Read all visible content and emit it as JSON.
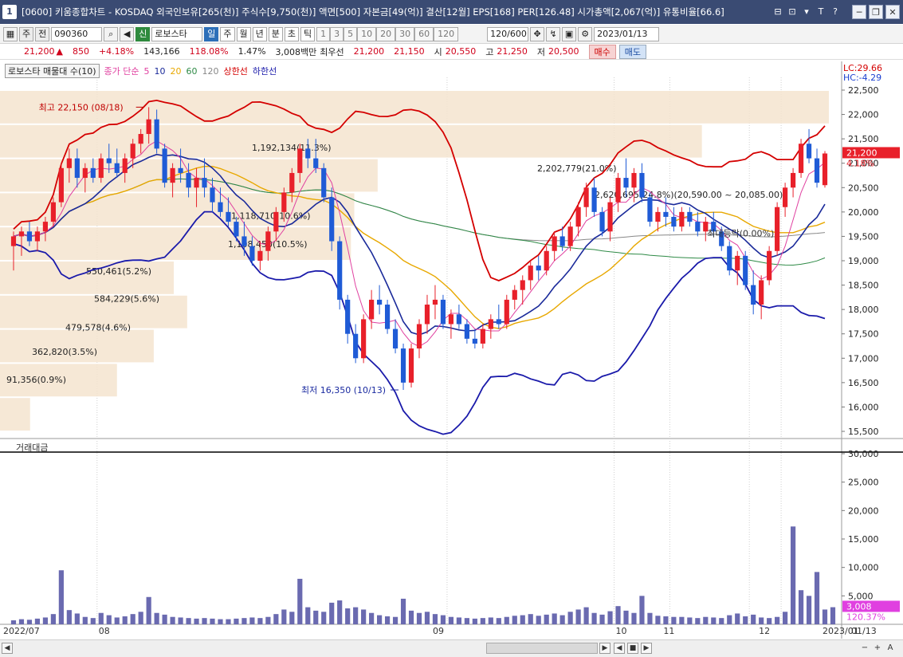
{
  "window": {
    "num": "1",
    "title": "[0600] 키움종합차트 - KOSDAQ 외국인보유[265(천)] 주식수[9,750(천)] 액면[500] 자본금[49(억)] 결산[12월] EPS[168] PER[126.48] 시가총액[2,067(억)] 유통비율[66.6]",
    "tools": [
      "⊟",
      "⊡",
      "▾",
      "T",
      "?"
    ],
    "minimize": "─",
    "restore": "❐",
    "close": "✕"
  },
  "toolbar": {
    "period": "주",
    "market": "전",
    "code": "090360",
    "credit": "신",
    "name": "로보스타",
    "tabs": [
      "일",
      "주",
      "월",
      "년",
      "분",
      "초",
      "틱"
    ],
    "active_tab": "일",
    "intervals": [
      "1",
      "3",
      "5",
      "10",
      "20",
      "30",
      "60",
      "120"
    ],
    "count": "120/600",
    "date": "2023/01/13"
  },
  "quote": {
    "price": "21,200",
    "arrow": "▲",
    "change": "850",
    "rate": "+4.18%",
    "volume": "143,166",
    "vol_ratio": "118.08%",
    "turnover": "1.47%",
    "amount": "3,008백만",
    "bid_label": "최우선",
    "bid1": "21,200",
    "bid2": "21,150",
    "open_label": "시",
    "open": "20,550",
    "high_label": "고",
    "high": "21,250",
    "low_label": "저",
    "low": "20,500",
    "buy": "매수",
    "sell": "매도"
  },
  "legend": {
    "indicator": "로보스타 매물대 수(10)",
    "ma_label": "종가 단순",
    "ma": [
      "5",
      "10",
      "20",
      "60",
      "120"
    ],
    "upper": "상한선",
    "lower": "하한선"
  },
  "colors": {
    "up": "#e8202a",
    "down": "#1f5bd6",
    "ma5": "#e040a0",
    "ma10": "#1a2a9a",
    "ma20": "#e8a800",
    "ma60": "#2e8a46",
    "ma120": "#888888",
    "bb": "#d40000",
    "bbLow": "#1a1aaa",
    "profile": "#f5e4cf",
    "volume": "#6a6ab0"
  },
  "chart_data": {
    "type": "candlestick",
    "price_axis": {
      "ticks": [
        "15,500",
        "16,000",
        "16,500",
        "17,000",
        "17,500",
        "18,000",
        "18,500",
        "19,000",
        "19,500",
        "20,000",
        "20,500",
        "21,000",
        "21,500",
        "22,000",
        "22,500"
      ],
      "lc": "LC:29.66",
      "hc": "HC:-4.29",
      "last": "21,200",
      "last_rate": "4.18%"
    },
    "volume_axis": {
      "title": "거래대금",
      "ticks": [
        "5,000",
        "10,000",
        "15,000",
        "20,000",
        "25,000",
        "30,000"
      ],
      "last": "3,008",
      "last_rate": "120.37%"
    },
    "x_labels": [
      "2022/07",
      "08",
      "09",
      "10",
      "11",
      "12",
      "2023/01",
      "01/13"
    ],
    "annotations": {
      "high": "최고 22,150 (08/18)",
      "low": "최저 16,350 (10/13)",
      "marker": "최대등락(0.00%)"
    },
    "volume_profile": [
      "91,356(0.9%)",
      "362,820(3.5%)",
      "479,578(4.6%)",
      "584,229(5.6%)",
      "550,461(5.2%)",
      "1,108,450(10.5%)",
      "1,118,710(10.6%)",
      "1,192,134(11.3%)",
      "2,202,779(21.0%)",
      "2,620,695(24.8%)(20,590.00 ~ 20,085.00)"
    ],
    "candles": [
      [
        19300,
        19600,
        18800,
        19500
      ],
      [
        19500,
        19700,
        19100,
        19600
      ],
      [
        19600,
        19800,
        19300,
        19400
      ],
      [
        19400,
        19700,
        19200,
        19600
      ],
      [
        19600,
        19900,
        19400,
        19800
      ],
      [
        19800,
        20300,
        19700,
        20200
      ],
      [
        20200,
        21000,
        20100,
        20900
      ],
      [
        20900,
        21300,
        20600,
        21100
      ],
      [
        21100,
        21300,
        20500,
        20700
      ],
      [
        20700,
        21000,
        20400,
        20900
      ],
      [
        20900,
        21100,
        20600,
        20700
      ],
      [
        20700,
        21200,
        20600,
        21100
      ],
      [
        21100,
        21400,
        20800,
        21000
      ],
      [
        21000,
        21300,
        20700,
        20800
      ],
      [
        20800,
        21200,
        20600,
        21100
      ],
      [
        21100,
        21500,
        20900,
        21400
      ],
      [
        21400,
        21700,
        21200,
        21600
      ],
      [
        21600,
        22150,
        21400,
        21900
      ],
      [
        21900,
        22100,
        21200,
        21300
      ],
      [
        21300,
        21400,
        20500,
        20600
      ],
      [
        20600,
        21000,
        20300,
        20900
      ],
      [
        20900,
        21300,
        20600,
        20800
      ],
      [
        20800,
        21000,
        20300,
        20500
      ],
      [
        20500,
        20900,
        20100,
        20700
      ],
      [
        20700,
        21100,
        20300,
        20500
      ],
      [
        20500,
        20700,
        20000,
        20200
      ],
      [
        20200,
        20500,
        19900,
        20000
      ],
      [
        20000,
        20300,
        19700,
        19800
      ],
      [
        19800,
        19900,
        19400,
        19500
      ],
      [
        19500,
        19800,
        19100,
        19300
      ],
      [
        19300,
        19500,
        18900,
        19000
      ],
      [
        19000,
        19400,
        18800,
        19200
      ],
      [
        19200,
        19700,
        19000,
        19600
      ],
      [
        19600,
        20100,
        19400,
        20000
      ],
      [
        20000,
        20500,
        19800,
        20400
      ],
      [
        20400,
        20900,
        20200,
        20800
      ],
      [
        20800,
        21400,
        20600,
        21300
      ],
      [
        21300,
        21500,
        20900,
        21100
      ],
      [
        21100,
        21500,
        20800,
        20900
      ],
      [
        20900,
        21000,
        20200,
        20300
      ],
      [
        20300,
        20500,
        19200,
        19400
      ],
      [
        19400,
        19500,
        18000,
        18200
      ],
      [
        18200,
        18300,
        17300,
        17500
      ],
      [
        17500,
        17700,
        16900,
        17000
      ],
      [
        17000,
        17900,
        16900,
        17800
      ],
      [
        17800,
        18400,
        17600,
        18200
      ],
      [
        18200,
        18500,
        17900,
        18100
      ],
      [
        18100,
        18200,
        17500,
        17600
      ],
      [
        17600,
        17800,
        17100,
        17200
      ],
      [
        17200,
        17300,
        16350,
        16500
      ],
      [
        16500,
        17300,
        16400,
        17200
      ],
      [
        17200,
        17800,
        17000,
        17700
      ],
      [
        17700,
        18300,
        17500,
        18100
      ],
      [
        18100,
        18500,
        17800,
        18200
      ],
      [
        18200,
        18300,
        17600,
        17700
      ],
      [
        17700,
        18000,
        17400,
        17900
      ],
      [
        17900,
        18100,
        17600,
        17700
      ],
      [
        17700,
        17800,
        17300,
        17400
      ],
      [
        17400,
        17600,
        17200,
        17300
      ],
      [
        17300,
        17700,
        17200,
        17600
      ],
      [
        17600,
        17900,
        17400,
        17800
      ],
      [
        17800,
        18100,
        17600,
        17700
      ],
      [
        17700,
        18300,
        17600,
        18200
      ],
      [
        18200,
        18500,
        18000,
        18400
      ],
      [
        18400,
        18700,
        18100,
        18600
      ],
      [
        18600,
        19000,
        18400,
        18900
      ],
      [
        18900,
        19100,
        18600,
        18800
      ],
      [
        18800,
        19300,
        18700,
        19200
      ],
      [
        19200,
        19600,
        19000,
        19500
      ],
      [
        19500,
        19700,
        19200,
        19300
      ],
      [
        19300,
        19800,
        19200,
        19700
      ],
      [
        19700,
        20200,
        19500,
        20100
      ],
      [
        20100,
        20600,
        19900,
        20500
      ],
      [
        20500,
        20700,
        19900,
        20000
      ],
      [
        20000,
        20100,
        19500,
        19600
      ],
      [
        19600,
        20300,
        19400,
        20200
      ],
      [
        20200,
        20800,
        20000,
        20700
      ],
      [
        20700,
        21100,
        20300,
        20500
      ],
      [
        20500,
        20900,
        20200,
        20800
      ],
      [
        20800,
        21000,
        20200,
        20300
      ],
      [
        20300,
        20400,
        19700,
        19800
      ],
      [
        19800,
        20100,
        19600,
        20000
      ],
      [
        20000,
        20300,
        19700,
        19900
      ],
      [
        19900,
        20100,
        19600,
        19700
      ],
      [
        19700,
        20100,
        19600,
        20000
      ],
      [
        20000,
        20100,
        19700,
        19800
      ],
      [
        19800,
        20000,
        19500,
        19600
      ],
      [
        19600,
        19900,
        19400,
        19800
      ],
      [
        19800,
        20000,
        19500,
        19600
      ],
      [
        19600,
        19700,
        19200,
        19300
      ],
      [
        19300,
        19400,
        18700,
        18800
      ],
      [
        18800,
        19200,
        18500,
        19100
      ],
      [
        19100,
        19200,
        18400,
        18500
      ],
      [
        18500,
        18800,
        17900,
        18100
      ],
      [
        18100,
        18700,
        17800,
        18600
      ],
      [
        18600,
        19300,
        18500,
        19200
      ],
      [
        19200,
        20200,
        19100,
        20100
      ],
      [
        20100,
        20600,
        19900,
        20500
      ],
      [
        20500,
        20900,
        20300,
        20800
      ],
      [
        20800,
        21500,
        20700,
        21400
      ],
      [
        21400,
        21700,
        21000,
        21100
      ],
      [
        21100,
        21300,
        20500,
        20600
      ],
      [
        20550,
        21250,
        20500,
        21200
      ]
    ],
    "volumes": [
      700,
      900,
      800,
      1000,
      1200,
      1800,
      9500,
      2500,
      1900,
      1300,
      1100,
      2000,
      1600,
      1200,
      1400,
      1800,
      2200,
      4800,
      2000,
      1700,
      1300,
      1200,
      1100,
      1000,
      1100,
      1000,
      900,
      900,
      1000,
      1100,
      1200,
      1100,
      1300,
      1800,
      2600,
      2200,
      8000,
      3000,
      2400,
      2200,
      3800,
      4200,
      2800,
      3000,
      2600,
      2000,
      1600,
      1400,
      1300,
      4500,
      2400,
      2000,
      2200,
      1800,
      1600,
      1300,
      1200,
      1100,
      1000,
      1100,
      1200,
      1100,
      1300,
      1500,
      1600,
      1800,
      1500,
      1700,
      1900,
      1600,
      2200,
      2600,
      3000,
      2000,
      1700,
      2300,
      3200,
      2400,
      2000,
      5000,
      2000,
      1500,
      1400,
      1300,
      1300,
      1200,
      1100,
      1300,
      1200,
      1100,
      1600,
      1900,
      1400,
      1700,
      1200,
      1100,
      1300,
      2200,
      17200,
      6000,
      5000,
      9200,
      2600,
      3008
    ]
  }
}
